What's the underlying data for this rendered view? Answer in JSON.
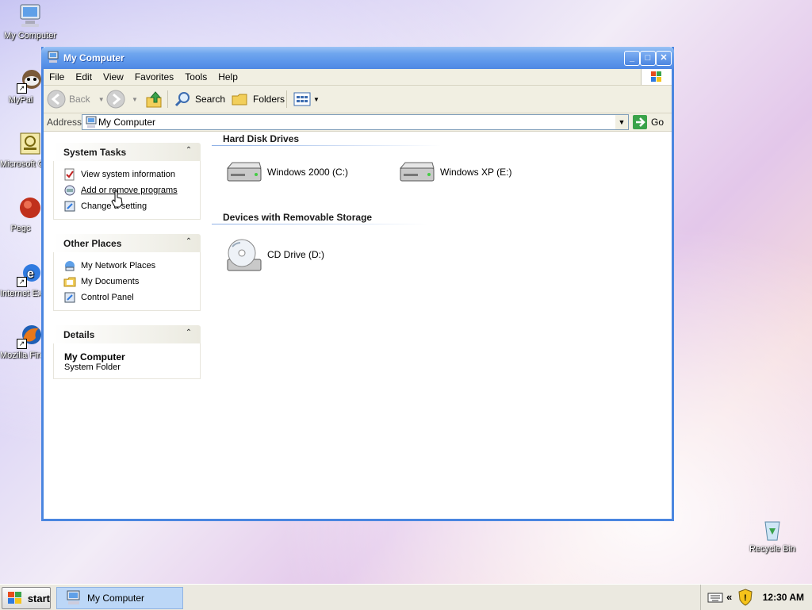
{
  "desktop": {
    "icons": [
      {
        "label": "My Computer"
      },
      {
        "label": "MyPal"
      },
      {
        "label": "Microsoft Outlook"
      },
      {
        "label": "Pegc"
      },
      {
        "label": "Internet Explorer"
      },
      {
        "label": "Mozilla Firefox"
      },
      {
        "label": "Recycle Bin"
      }
    ]
  },
  "window": {
    "title": "My Computer",
    "controls": {
      "minimize": "_",
      "maximize": "□",
      "close": "✕"
    },
    "menu": [
      "File",
      "Edit",
      "View",
      "Favorites",
      "Tools",
      "Help"
    ],
    "toolbar": {
      "back": "Back",
      "search": "Search",
      "folders": "Folders"
    },
    "address": {
      "label": "Address",
      "value": "My Computer",
      "go": "Go"
    }
  },
  "sidebar": {
    "system_tasks": {
      "title": "System Tasks",
      "items": [
        "View system information",
        "Add or remove programs",
        "Change a setting"
      ]
    },
    "other_places": {
      "title": "Other Places",
      "items": [
        "My Network Places",
        "My Documents",
        "Control Panel"
      ]
    },
    "details": {
      "title": "Details",
      "name": "My Computer",
      "type": "System Folder"
    }
  },
  "content": {
    "hard_disk_group": "Hard Disk Drives",
    "hard_drives": [
      "Windows 2000 (C:)",
      "Windows XP (E:)"
    ],
    "removable_group": "Devices with Removable Storage",
    "removable": [
      "CD Drive (D:)"
    ]
  },
  "taskbar": {
    "start": "start",
    "active_task": "My Computer",
    "tray_chevron": "«",
    "clock": "12:30 AM"
  },
  "colors": {
    "title_blue": "#5b95ea",
    "window_border": "#4a86e0",
    "chrome_bg": "#f1efe2",
    "active_task_bg": "#bcd7f7"
  }
}
